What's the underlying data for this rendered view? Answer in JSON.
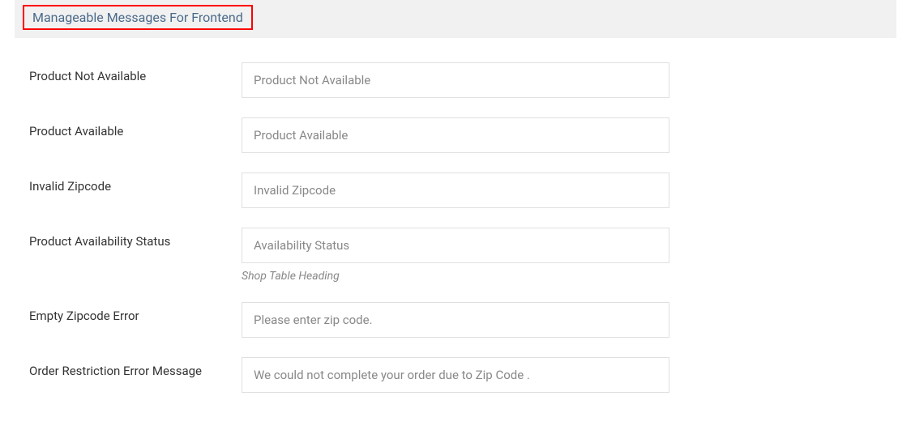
{
  "section": {
    "title": "Manageable Messages For Frontend"
  },
  "fields": {
    "product_not_available": {
      "label": "Product Not Available",
      "value": "Product Not Available"
    },
    "product_available": {
      "label": "Product Available",
      "value": "Product Available"
    },
    "invalid_zipcode": {
      "label": "Invalid Zipcode",
      "value": "Invalid Zipcode"
    },
    "product_availability_status": {
      "label": "Product Availability Status",
      "value": "Availability Status",
      "hint": "Shop Table Heading"
    },
    "empty_zipcode_error": {
      "label": "Empty Zipcode Error",
      "value": "Please enter zip code."
    },
    "order_restriction_error": {
      "label": "Order Restriction Error Message",
      "value": "We could not complete your order due to Zip Code ."
    }
  }
}
